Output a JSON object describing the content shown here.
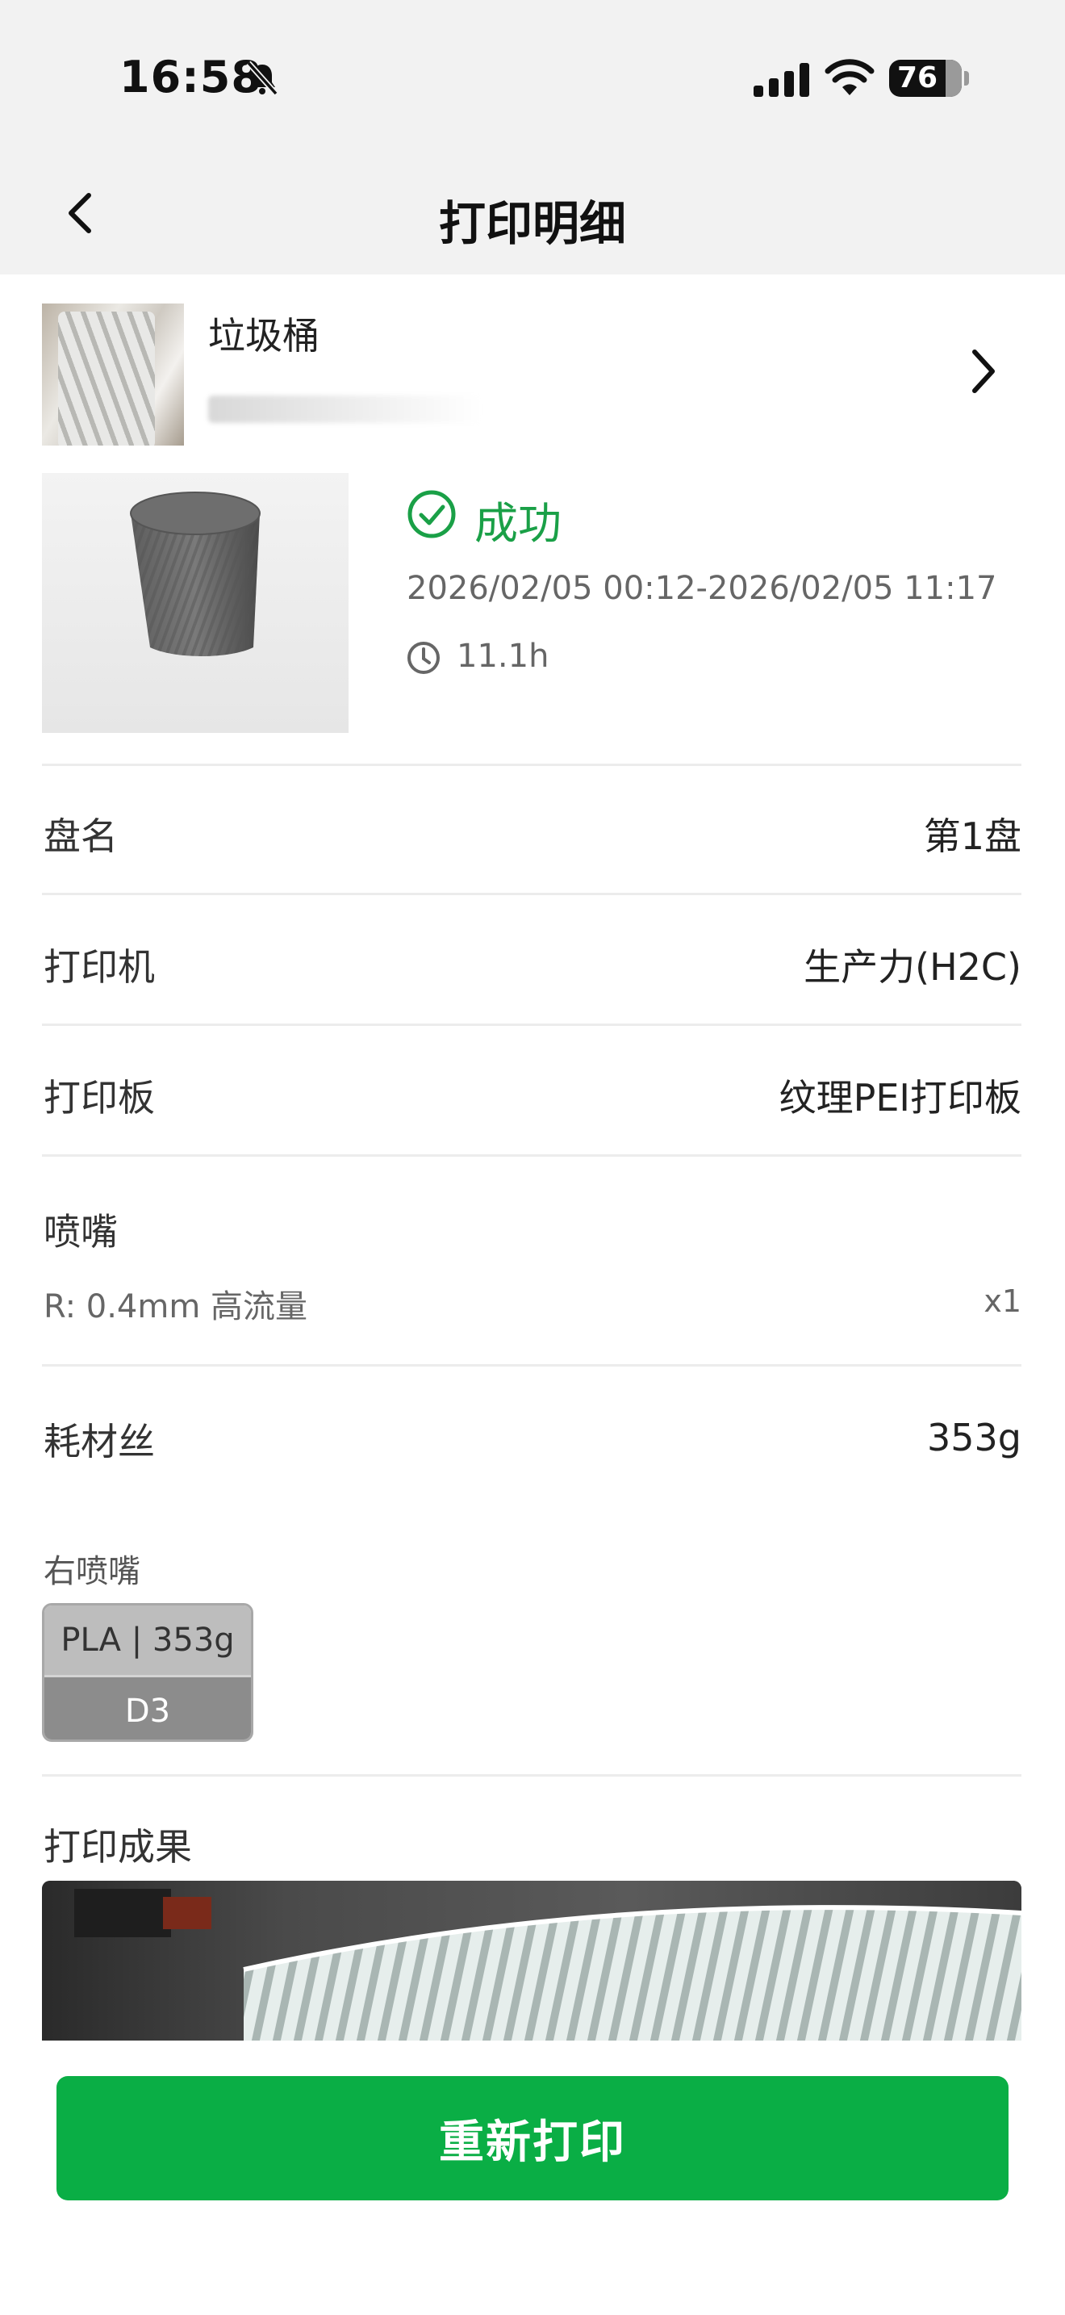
{
  "status_bar": {
    "time": "16:58",
    "battery": "76"
  },
  "nav": {
    "title": "打印明细"
  },
  "model": {
    "name": "垃圾桶"
  },
  "job": {
    "status": "成功",
    "time_range": "2026/02/05 00:12-2026/02/05 11:17",
    "duration": "11.1h"
  },
  "details": {
    "plate_label": "盘名",
    "plate_value": "第1盘",
    "printer_label": "打印机",
    "printer_value": "生产力(H2C)",
    "bed_label": "打印板",
    "bed_value": "纹理PEI打印板",
    "nozzle_label": "喷嘴",
    "nozzle_detail": "R: 0.4mm 高流量",
    "nozzle_count": "x1",
    "filament_label": "耗材丝",
    "filament_total": "353g",
    "right_nozzle_label": "右喷嘴",
    "filament_chip_top": "PLA | 353g",
    "filament_chip_bottom": "D3",
    "result_label": "打印成果"
  },
  "actions": {
    "reprint_label": "重新打印"
  },
  "colors": {
    "accent_green": "#0aae45",
    "success_green": "#1aa047"
  }
}
